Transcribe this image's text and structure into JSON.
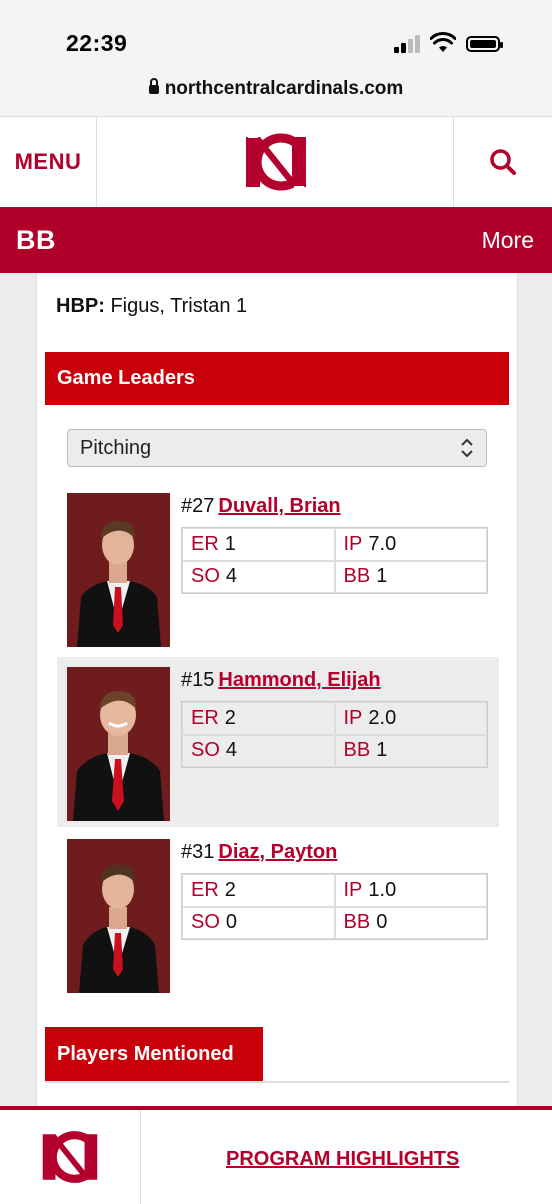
{
  "status_bar": {
    "time": "22:39"
  },
  "browser": {
    "url": "northcentralcardinals.com"
  },
  "header": {
    "menu_label": "MENU",
    "logo_icon": "nc-cardinals-logo",
    "search_icon": "search-icon",
    "accent_color": "#b3002d"
  },
  "sport_bar": {
    "sport": "BB",
    "more_label": "More"
  },
  "box_notes": {
    "hbp_label": "HBP:",
    "hbp_value": "Figus, Tristan 1"
  },
  "game_leaders": {
    "title": "Game Leaders",
    "category_selected": "Pitching",
    "players": [
      {
        "number": "#27",
        "name": "Duvall, Brian",
        "stats": [
          {
            "label": "ER",
            "value": "1"
          },
          {
            "label": "IP",
            "value": "7.0"
          },
          {
            "label": "SO",
            "value": "4"
          },
          {
            "label": "BB",
            "value": "1"
          }
        ]
      },
      {
        "number": "#15",
        "name": "Hammond, Elijah",
        "stats": [
          {
            "label": "ER",
            "value": "2"
          },
          {
            "label": "IP",
            "value": "2.0"
          },
          {
            "label": "SO",
            "value": "4"
          },
          {
            "label": "BB",
            "value": "1"
          }
        ]
      },
      {
        "number": "#31",
        "name": "Diaz, Payton",
        "stats": [
          {
            "label": "ER",
            "value": "2"
          },
          {
            "label": "IP",
            "value": "1.0"
          },
          {
            "label": "SO",
            "value": "0"
          },
          {
            "label": "BB",
            "value": "0"
          }
        ]
      }
    ]
  },
  "players_mentioned": {
    "title": "Players Mentioned"
  },
  "bottom_bar": {
    "link_label": "PROGRAM HIGHLIGHTS"
  }
}
